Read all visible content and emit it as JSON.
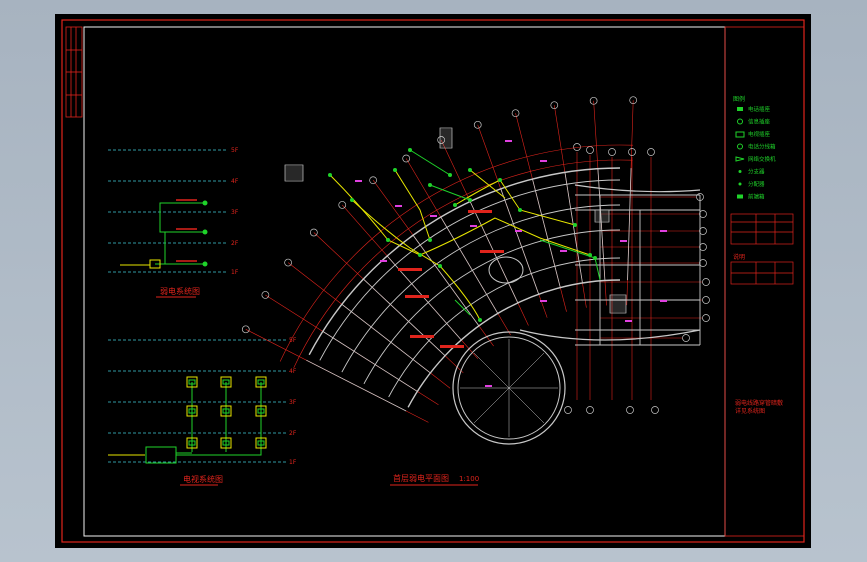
{
  "colors": {
    "background": "#000000",
    "frame": "#e0241c",
    "wall": "#c8c8c8",
    "cyan": "#3fc9d8",
    "yellow": "#e7e600",
    "green": "#1fd32a",
    "magenta": "#e040e0",
    "axis": "#e0241c"
  },
  "plan": {
    "title": "首层弱电平面图",
    "scale": "1:100"
  },
  "riser_top": {
    "title": "弱电系统图",
    "floors": [
      "5F",
      "4F",
      "3F",
      "2F",
      "1F"
    ]
  },
  "riser_bottom": {
    "title": "电视系统图",
    "floors": [
      "5F",
      "4F",
      "3F",
      "2F",
      "1F"
    ]
  },
  "legend": {
    "title": "图例",
    "items": [
      "电话插座",
      "信息插座",
      "电视插座",
      "电话分线箱",
      "网络交换机",
      "分支器",
      "分配器",
      "前端箱"
    ]
  },
  "notes": {
    "title": "说明",
    "lines": [
      "弱电线路穿管暗敷",
      "详见系统图"
    ]
  }
}
